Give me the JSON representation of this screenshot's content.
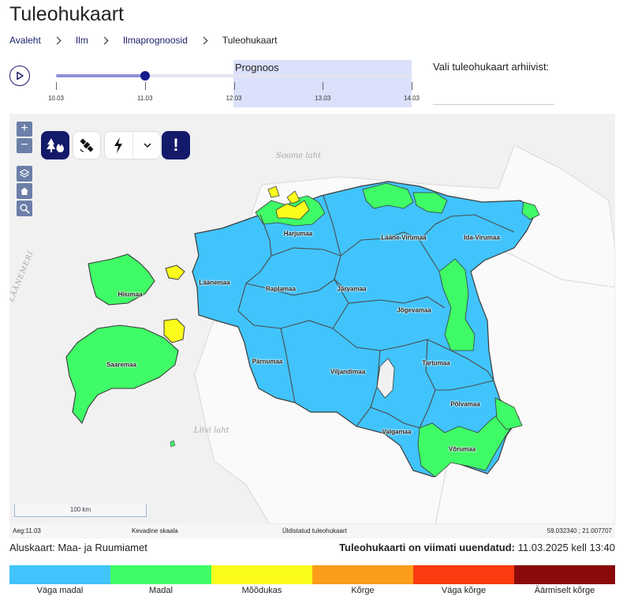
{
  "page": {
    "title": "Tuleohukaart"
  },
  "breadcrumb": {
    "items": [
      {
        "label": "Avaleht"
      },
      {
        "label": "Ilm"
      },
      {
        "label": "Ilmaprognoosid"
      },
      {
        "label": "Tuleohukaart"
      }
    ]
  },
  "timeline": {
    "forecast_label": "Prognoos",
    "dates": [
      "10.03",
      "11.03",
      "12.03",
      "13.03",
      "14.03"
    ],
    "selected_date": "11.03",
    "forecast_from": "12.03"
  },
  "archive": {
    "label": "Vali tuleohukaart arhiivist:",
    "value": ""
  },
  "map": {
    "controls": {
      "zoom_in": "+",
      "zoom_out": "−"
    },
    "tools": [
      {
        "name": "forest-fire-icon"
      },
      {
        "name": "satellite-icon"
      },
      {
        "name": "lightning-icon"
      },
      {
        "name": "chevron-down-icon"
      },
      {
        "name": "warning-icon",
        "symbol": "!"
      }
    ],
    "scale_label": "100 km",
    "sea_labels": {
      "north": "Soome laht",
      "south": "Liivi laht",
      "west": "LÄÄNEMERI"
    },
    "regions": [
      {
        "name": "Harjumaa",
        "level": "Väga madal"
      },
      {
        "name": "Lääne-Virumaa",
        "level": "Väga madal"
      },
      {
        "name": "Ida-Virumaa",
        "level": "Väga madal"
      },
      {
        "name": "Läänemaa",
        "level": "Väga madal"
      },
      {
        "name": "Hiiumaa",
        "level": "Madal"
      },
      {
        "name": "Raplamaa",
        "level": "Väga madal"
      },
      {
        "name": "Järvamaa",
        "level": "Väga madal"
      },
      {
        "name": "Jõgevamaa",
        "level": "Väga madal"
      },
      {
        "name": "Saaremaa",
        "level": "Madal"
      },
      {
        "name": "Pärnumaa",
        "level": "Väga madal"
      },
      {
        "name": "Tartumaa",
        "level": "Väga madal"
      },
      {
        "name": "Viljandimaa",
        "level": "Väga madal"
      },
      {
        "name": "Põlvamaa",
        "level": "Väga madal"
      },
      {
        "name": "Valgamaa",
        "level": "Väga madal"
      },
      {
        "name": "Võrumaa",
        "level": "Madal"
      }
    ]
  },
  "status_bar": {
    "time": "Aeg:11.03",
    "scale": "Kevadine skaala",
    "type": "Üldistatud tuleohukaart",
    "coords": "59.032340 ; 21.007707"
  },
  "footer": {
    "basemap": "Aluskaart: Maa- ja Ruumiamet",
    "updated_label": "Tuleohukaarti on viimati uuendatud:",
    "updated_value": "11.03.2025 kell 13:40"
  },
  "legend": {
    "items": [
      {
        "label": "Väga madal",
        "color": "#40c4fb"
      },
      {
        "label": "Madal",
        "color": "#3ffb66"
      },
      {
        "label": "Mõõdukas",
        "color": "#fbfb1c"
      },
      {
        "label": "Kõrge",
        "color": "#fb9d1a"
      },
      {
        "label": "Väga kõrge",
        "color": "#fb3c11"
      },
      {
        "label": "Äärmiselt kõrge",
        "color": "#8a0a0a"
      }
    ]
  }
}
